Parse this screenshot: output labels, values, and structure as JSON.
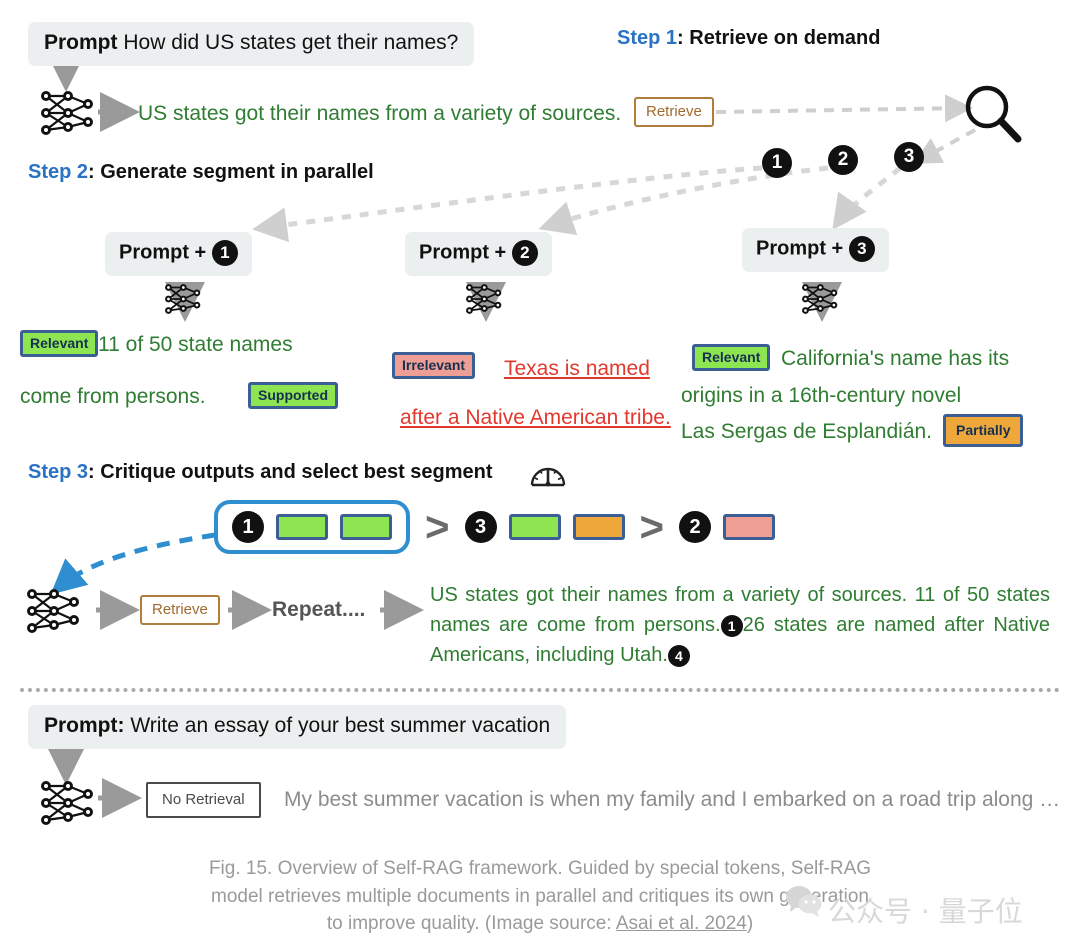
{
  "top_prompt": {
    "label": "Prompt",
    "text": "How did US states get their names?"
  },
  "step1": {
    "heading_num": "Step 1",
    "heading_text": ": Retrieve on demand",
    "model_output": "US states got their names from a variety of sources.",
    "retrieve_token": "Retrieve",
    "search_icon": "magnifier-icon",
    "docs": [
      "1",
      "2",
      "3"
    ]
  },
  "step2": {
    "heading_num": "Step 2",
    "heading_text": ": Generate segment in parallel",
    "columns": [
      {
        "prompt_label": "Prompt + ",
        "doc": "1",
        "tag_relevance": "Relevant",
        "tag_support": "Supported",
        "line1": "11 of 50 state names",
        "line2": "come from persons.",
        "text_color": "#2f7d32"
      },
      {
        "prompt_label": "Prompt + ",
        "doc": "2",
        "tag_relevance": "Irrelevant",
        "line1": "Texas is named",
        "line2": "after a Native American tribe.",
        "text_color": "#e3382e"
      },
      {
        "prompt_label": "Prompt + ",
        "doc": "3",
        "tag_relevance": "Relevant",
        "tag_support": "Partially",
        "line1": "California's name has its",
        "line2": "origins  in  a  16th-century  novel",
        "line3": "Las Sergas de Esplandián.",
        "text_color": "#2f7d32"
      }
    ]
  },
  "step3": {
    "heading_num": "Step 3",
    "heading_text": ": Critique outputs and select best segment",
    "gauge_icon": "gauge-icon",
    "ranking": [
      {
        "doc": "1",
        "swatches": [
          "green",
          "green"
        ],
        "selected": true
      },
      {
        "doc": "3",
        "swatches": [
          "green",
          "orange"
        ],
        "selected": false
      },
      {
        "doc": "2",
        "swatches": [
          "red"
        ],
        "selected": false
      }
    ],
    "comparator": ">",
    "retrieve_token": "Retrieve",
    "repeat_label": "Repeat....",
    "final_answer": {
      "part1": "US  states  got  their  names  from  a  variety  of  sources. 11  of  50 states  names  are  come  from  persons.",
      "marker1": "1",
      "part2": "26 states are named after Native Americans, including Utah.",
      "marker2": "4"
    }
  },
  "bottom": {
    "prompt_label": "Prompt:",
    "prompt_text": " Write an essay of your best summer vacation",
    "no_retrieval_token": "No Retrieval",
    "answer": "My best summer vacation is when my family and I embarked on a road trip along …"
  },
  "caption": {
    "line1": "Fig. 15. Overview of Self-RAG framework. Guided by special tokens, Self-RAG",
    "line2": "model retrieves multiple documents in parallel and critiques its own generation",
    "line3_pre": "to improve quality. (Image source: ",
    "line3_link": "Asai et al. 2024",
    "line3_post": ")"
  },
  "watermark": {
    "text": "公众号 · 量子位",
    "icon": "wechat-icon"
  },
  "colors": {
    "accent_blue": "#2a72c4",
    "green_text": "#2f7d32",
    "red_text": "#e3382e",
    "tag_green": "#8ee552",
    "tag_red": "#ef9e96",
    "tag_orange": "#eda73a",
    "tag_border": "#3b5f94",
    "retrieve_brown": "#a06a2c",
    "select_blue": "#2f8ed0"
  }
}
